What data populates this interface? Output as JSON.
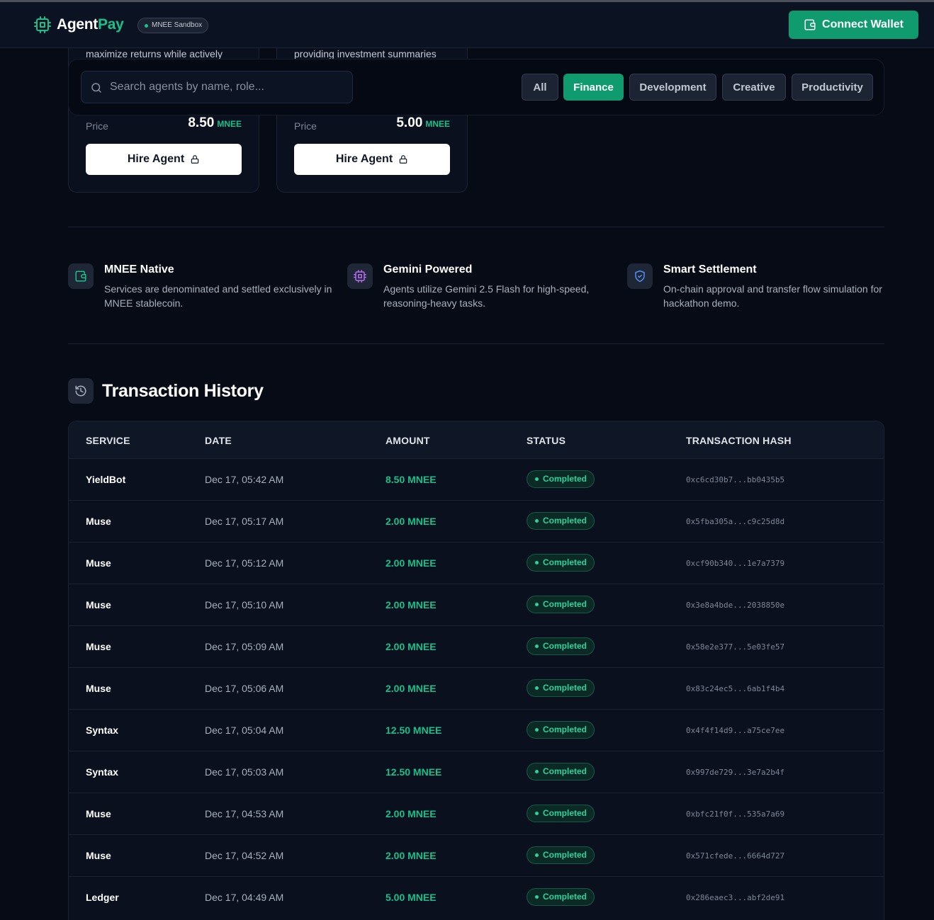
{
  "header": {
    "brand_part1": "Agent",
    "brand_part2": "Pay",
    "sandbox_label": "MNEE Sandbox",
    "connect_label": "Connect Wallet"
  },
  "cards": [
    {
      "desc": "maximize returns while actively",
      "price_label": "Price",
      "price": "8.50",
      "unit": "MNEE",
      "hire_label": "Hire Agent"
    },
    {
      "desc": "providing investment summaries",
      "price_label": "Price",
      "price": "5.00",
      "unit": "MNEE",
      "hire_label": "Hire Agent"
    }
  ],
  "filters": {
    "search_placeholder": "Search agents by name, role...",
    "chips": [
      "All",
      "Finance",
      "Development",
      "Creative",
      "Productivity"
    ],
    "active": "Finance"
  },
  "features": [
    {
      "icon": "wallet-icon",
      "title": "MNEE Native",
      "desc": "Services are denominated and settled exclusively in MNEE stablecoin."
    },
    {
      "icon": "cpu-icon",
      "title": "Gemini Powered",
      "desc": "Agents utilize Gemini 2.5 Flash for high-speed, reasoning-heavy tasks."
    },
    {
      "icon": "shield-check-icon",
      "title": "Smart Settlement",
      "desc": "On-chain approval and transfer flow simulation for hackathon demo."
    }
  ],
  "transactions": {
    "title": "Transaction History",
    "columns": [
      "SERVICE",
      "DATE",
      "AMOUNT",
      "STATUS",
      "TRANSACTION HASH"
    ],
    "rows": [
      {
        "service": "YieldBot",
        "date": "Dec 17, 05:42 AM",
        "amount": "8.50 MNEE",
        "status": "Completed",
        "hash": "0xc6cd30b7...bb0435b5"
      },
      {
        "service": "Muse",
        "date": "Dec 17, 05:17 AM",
        "amount": "2.00 MNEE",
        "status": "Completed",
        "hash": "0x5fba305a...c9c25d8d"
      },
      {
        "service": "Muse",
        "date": "Dec 17, 05:12 AM",
        "amount": "2.00 MNEE",
        "status": "Completed",
        "hash": "0xcf90b340...1e7a7379"
      },
      {
        "service": "Muse",
        "date": "Dec 17, 05:10 AM",
        "amount": "2.00 MNEE",
        "status": "Completed",
        "hash": "0x3e8a4bde...2038850e"
      },
      {
        "service": "Muse",
        "date": "Dec 17, 05:09 AM",
        "amount": "2.00 MNEE",
        "status": "Completed",
        "hash": "0x58e2e377...5e03fe57"
      },
      {
        "service": "Muse",
        "date": "Dec 17, 05:06 AM",
        "amount": "2.00 MNEE",
        "status": "Completed",
        "hash": "0x83c24ec5...6ab1f4b4"
      },
      {
        "service": "Syntax",
        "date": "Dec 17, 05:04 AM",
        "amount": "12.50 MNEE",
        "status": "Completed",
        "hash": "0x4f4f14d9...a75ce7ee"
      },
      {
        "service": "Syntax",
        "date": "Dec 17, 05:03 AM",
        "amount": "12.50 MNEE",
        "status": "Completed",
        "hash": "0x997de729...3e7a2b4f"
      },
      {
        "service": "Muse",
        "date": "Dec 17, 04:53 AM",
        "amount": "2.00 MNEE",
        "status": "Completed",
        "hash": "0xbfc21f0f...535a7a69"
      },
      {
        "service": "Muse",
        "date": "Dec 17, 04:52 AM",
        "amount": "2.00 MNEE",
        "status": "Completed",
        "hash": "0x571cfede...6664d727"
      },
      {
        "service": "Ledger",
        "date": "Dec 17, 04:49 AM",
        "amount": "5.00 MNEE",
        "status": "Completed",
        "hash": "0x286eaec3...abf2de91"
      }
    ]
  },
  "colors": {
    "accent": "#0f9b6e",
    "accent_text": "#19c08a",
    "background": "#070b16"
  }
}
